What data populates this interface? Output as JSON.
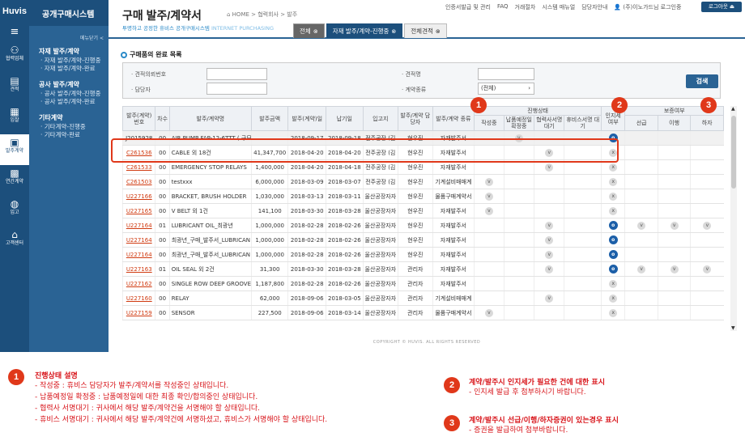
{
  "brand": {
    "logo": "Huvis",
    "system_title": "공개구매시스템"
  },
  "rail": [
    {
      "label": "협력업체",
      "icon": "users-icon"
    },
    {
      "label": "견적",
      "icon": "document-icon"
    },
    {
      "label": "입찰",
      "icon": "clipboard-icon"
    },
    {
      "label": "발주계약",
      "icon": "contract-icon"
    },
    {
      "label": "연간계약",
      "icon": "calendar-icon"
    },
    {
      "label": "입고",
      "icon": "globe-icon"
    },
    {
      "label": "고객센터",
      "icon": "gift-icon"
    }
  ],
  "menu": {
    "toggle": "메뉴닫기 <",
    "groups": [
      {
        "title": "자재 발주/계약",
        "items": [
          "· 자재 발주/계약-진행중",
          "· 자재 발주/계약-완료"
        ]
      },
      {
        "title": "공사 발주/계약",
        "items": [
          "· 공사 발주/계약-진행중",
          "· 공사 발주/계약-완료"
        ]
      },
      {
        "title": "기타계약",
        "items": [
          "· 기타계약-진행중",
          "· 기타계약-완료"
        ]
      }
    ]
  },
  "header": {
    "title": "구매 발주/계약서",
    "breadcrumb": "⌂ HOME > 협력회사 > 발주",
    "slogan": "투명하고 공정한 휴비스 공개구매시스템",
    "slogan_en": "INTERNET PURCHASING",
    "toplinks": [
      "인증서발급 및 관리",
      "FAQ",
      "거래절차",
      "시스템 매뉴얼",
      "담당자안내",
      "👤 (주)이노가드님 로그인중"
    ],
    "logout": "로그아웃 ⏏"
  },
  "tabs": [
    {
      "label": "전체"
    },
    {
      "label": "자재 발주/계약-진행중"
    },
    {
      "label": "전체견적"
    }
  ],
  "section_title": "구매품의 완료 목록",
  "search": {
    "fields": [
      {
        "label": "· 견적의뢰번호"
      },
      {
        "label": "· 견적명"
      },
      {
        "label": "· 담당자"
      },
      {
        "label": "· 계약종류",
        "value": "(전체)"
      }
    ],
    "button": "검색"
  },
  "table": {
    "group_progress": "진행상태",
    "group_stamp": "인지세 여부",
    "group_guarantee": "보증여부",
    "headers": [
      "발주(계약)번호",
      "차수",
      "발주/계약명",
      "발주금액",
      "발주(계약)일",
      "납기일",
      "입고지",
      "발주/계약 담당자",
      "발주/계약 종류",
      "작성중",
      "납품예정일 확정중",
      "협력사서명 대기",
      "휴비스서명 대기",
      "인지세 여부",
      "선급",
      "이행",
      "하자"
    ],
    "rows": [
      {
        "no": "J2015928",
        "seq": "00",
        "name": "AIR PUMP FAP-12-6TTT ( 구모",
        "amount": "",
        "date": "2018-09-17",
        "due": "2018-09-18",
        "place": "전주공장 (김",
        "mgr": "현우진",
        "kind": "자재발주서",
        "s1": "",
        "s2": "v",
        "s3": "",
        "s4": "",
        "stamp": "o",
        "g1": "",
        "g2": "",
        "g3": "",
        "link": false,
        "hl": true
      },
      {
        "no": "C261536",
        "seq": "00",
        "name": "CABLE 외 18건",
        "amount": "41,347,700",
        "date": "2018-04-20",
        "due": "2018-04-20",
        "place": "전주공장 (김",
        "mgr": "현우진",
        "kind": "자재발주서",
        "s1": "",
        "s2": "",
        "s3": "v",
        "s4": "",
        "stamp": "x",
        "g1": "",
        "g2": "",
        "g3": "",
        "link": true
      },
      {
        "no": "C261533",
        "seq": "00",
        "name": "EMERGENCY STOP RELAYS",
        "amount": "1,400,000",
        "date": "2018-04-20",
        "due": "2018-04-18",
        "place": "전주공장 (김",
        "mgr": "현우진",
        "kind": "자재발주서",
        "s1": "",
        "s2": "",
        "s3": "v",
        "s4": "",
        "stamp": "x",
        "g1": "",
        "g2": "",
        "g3": "",
        "link": true
      },
      {
        "no": "C261503",
        "seq": "00",
        "name": "testxxx",
        "amount": "6,000,000",
        "date": "2018-03-09",
        "due": "2018-03-07",
        "place": "전주공장 (김",
        "mgr": "현우진",
        "kind": "기계설비매매계",
        "s1": "v",
        "s2": "",
        "s3": "",
        "s4": "",
        "stamp": "x",
        "g1": "",
        "g2": "",
        "g3": "",
        "link": true
      },
      {
        "no": "U227166",
        "seq": "00",
        "name": "BRACKET, BRUSH HOLDER",
        "amount": "1,030,000",
        "date": "2018-03-13",
        "due": "2018-03-11",
        "place": "울산공장자자",
        "mgr": "현우진",
        "kind": "물품구매계약서",
        "s1": "v",
        "s2": "",
        "s3": "",
        "s4": "",
        "stamp": "x",
        "g1": "",
        "g2": "",
        "g3": "",
        "link": true
      },
      {
        "no": "U227165",
        "seq": "00",
        "name": "V BELT 외 1건",
        "amount": "141,100",
        "date": "2018-03-30",
        "due": "2018-03-28",
        "place": "울산공장자자",
        "mgr": "현우진",
        "kind": "자재발주서",
        "s1": "v",
        "s2": "",
        "s3": "",
        "s4": "",
        "stamp": "x",
        "g1": "",
        "g2": "",
        "g3": "",
        "link": true
      },
      {
        "no": "U227164",
        "seq": "01",
        "name": "LUBRICANT OIL_최광년",
        "amount": "1,000,000",
        "date": "2018-02-28",
        "due": "2018-02-26",
        "place": "울산공장자자",
        "mgr": "현우진",
        "kind": "자재발주서",
        "s1": "",
        "s2": "",
        "s3": "v",
        "s4": "",
        "stamp": "o",
        "g1": "v",
        "g2": "v",
        "g3": "v",
        "link": true
      },
      {
        "no": "U227164",
        "seq": "00",
        "name": "최광년_구매_발주서_LUBRICAN",
        "amount": "1,000,000",
        "date": "2018-02-28",
        "due": "2018-02-26",
        "place": "울산공장자자",
        "mgr": "현우진",
        "kind": "자재발주서",
        "s1": "",
        "s2": "",
        "s3": "v",
        "s4": "",
        "stamp": "o",
        "g1": "",
        "g2": "",
        "g3": "",
        "link": true
      },
      {
        "no": "U227164",
        "seq": "00",
        "name": "최광년_구매_발주서_LUBRICAN",
        "amount": "1,000,000",
        "date": "2018-02-28",
        "due": "2018-02-26",
        "place": "울산공장자자",
        "mgr": "현우진",
        "kind": "자재발주서",
        "s1": "",
        "s2": "",
        "s3": "v",
        "s4": "",
        "stamp": "o",
        "g1": "",
        "g2": "",
        "g3": "",
        "link": true
      },
      {
        "no": "U227163",
        "seq": "01",
        "name": "OIL SEAL 외 2건",
        "amount": "31,300",
        "date": "2018-03-30",
        "due": "2018-03-28",
        "place": "울산공장자자",
        "mgr": "관리자",
        "kind": "자재발주서",
        "s1": "",
        "s2": "",
        "s3": "v",
        "s4": "",
        "stamp": "o",
        "g1": "v",
        "g2": "v",
        "g3": "v",
        "link": true
      },
      {
        "no": "U227162",
        "seq": "00",
        "name": "SINGLE ROW DEEP GROOVE B",
        "amount": "1,187,800",
        "date": "2018-02-28",
        "due": "2018-02-26",
        "place": "울산공장자자",
        "mgr": "관리자",
        "kind": "자재발주서",
        "s1": "",
        "s2": "",
        "s3": "",
        "s4": "",
        "stamp": "x",
        "g1": "",
        "g2": "",
        "g3": "",
        "link": true
      },
      {
        "no": "U227160",
        "seq": "00",
        "name": "RELAY",
        "amount": "62,000",
        "date": "2018-09-06",
        "due": "2018-03-05",
        "place": "울산공장자자",
        "mgr": "관리자",
        "kind": "기계설비매매계",
        "s1": "",
        "s2": "",
        "s3": "v",
        "s4": "",
        "stamp": "x",
        "g1": "",
        "g2": "",
        "g3": "",
        "link": true
      },
      {
        "no": "U227159",
        "seq": "00",
        "name": "SENSOR",
        "amount": "227,500",
        "date": "2018-09-06",
        "due": "2018-03-14",
        "place": "울산공장자자",
        "mgr": "관리자",
        "kind": "물품구매계약서",
        "s1": "v",
        "s2": "",
        "s3": "",
        "s4": "",
        "stamp": "x",
        "g1": "",
        "g2": "",
        "g3": "",
        "link": true
      }
    ]
  },
  "copyright": "COPYRIGHT © HUVIS. ALL RIGHTS RESERVED",
  "badges": [
    "1",
    "2",
    "3"
  ],
  "notes": {
    "n1": {
      "title": "진행상태 설명",
      "lines": [
        "- 작성중 : 휴비스 담당자가 발주/계약서를 작성중인 상태입니다.",
        "- 납품예정일 확정중 : 납품예정일에 대한 최종 확인/합의중인 상태입니다.",
        "- 협력사 서명대기 : 귀사에서 해당 발주/계약건을 서명해야 할 상태입니다.",
        "- 휴비스 서명대기 : 귀사에서 해당 발주/계약건에 서명하셨고, 휴비스가 서명해야 할 상태입니다."
      ]
    },
    "n2": {
      "title": "계약/발주시 인지세가 필요한 건에 대한 표시",
      "lines": [
        "- 인지세 발급 후 첨부하시기 바랍니다."
      ]
    },
    "n3": {
      "title": "계약/발주시 선급/이행/하자증권이 있는경우 표시",
      "lines": [
        "- 증권을 발급하여 첨부바랍니다."
      ]
    }
  },
  "colors": {
    "navy": "#1c4f7c",
    "menu": "#2a6394",
    "accent": "#e0381a",
    "stamp_on": "#1c5fa8"
  }
}
